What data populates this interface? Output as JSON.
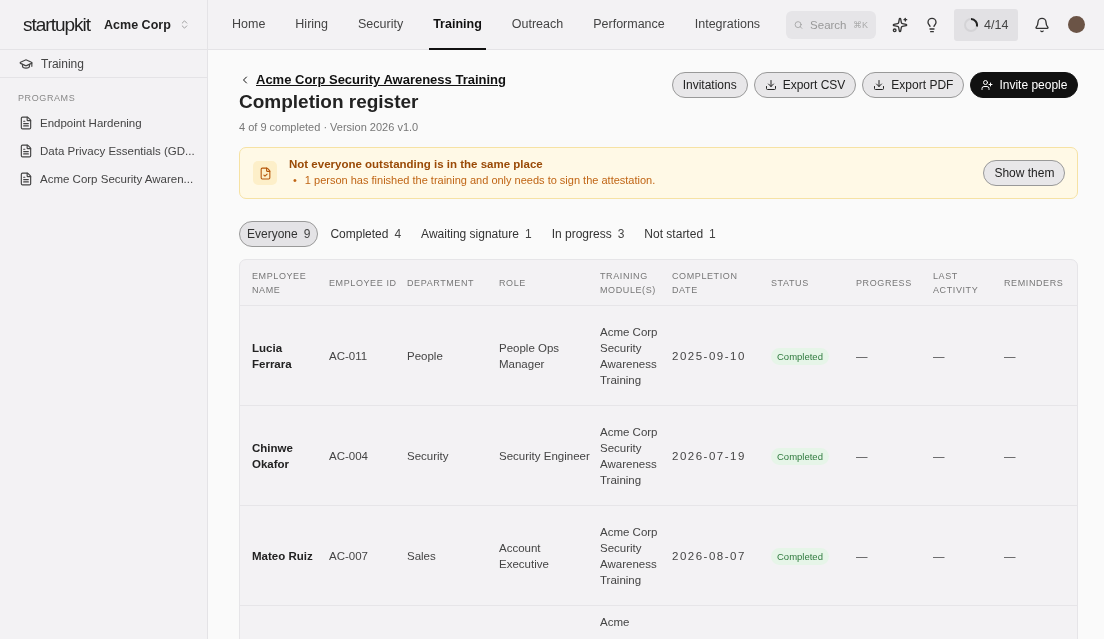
{
  "brand": {
    "logo": "startupkit",
    "org": "Acme Corp"
  },
  "nav": [
    {
      "label": "Home",
      "selected": false
    },
    {
      "label": "Hiring",
      "selected": false
    },
    {
      "label": "Security",
      "selected": false
    },
    {
      "label": "Training",
      "selected": true
    },
    {
      "label": "Outreach",
      "selected": false
    },
    {
      "label": "Performance",
      "selected": false
    },
    {
      "label": "Integrations",
      "selected": false
    }
  ],
  "search": {
    "placeholder": "Search",
    "shortcut": "⌘K"
  },
  "progress_chip": {
    "label": "4/14",
    "level": 0.29
  },
  "sidebar": {
    "header": "Training",
    "section": "PROGRAMS",
    "items": [
      {
        "label": "Endpoint Hardening",
        "selected": false
      },
      {
        "label": "Data Privacy Essentials (GD...",
        "selected": false
      },
      {
        "label": "Acme Corp Security Awaren...",
        "selected": false
      }
    ]
  },
  "page": {
    "back_link": "Acme Corp Security Awareness Training",
    "title": "Completion register",
    "subtitle": "4 of 9 completed · Version 2026 v1.0",
    "actions": [
      {
        "label": "Invitations",
        "kind": "plain"
      },
      {
        "label": "Export CSV",
        "kind": "download"
      },
      {
        "label": "Export PDF",
        "kind": "download"
      },
      {
        "label": "Invite people",
        "kind": "primary"
      }
    ]
  },
  "notice": {
    "title": "Not everyone outstanding is in the same place",
    "bullet": "•",
    "items": [
      "1 person has finished the training and only needs to sign the attestation."
    ],
    "button": "Show them"
  },
  "filters": [
    {
      "label": "Everyone",
      "count": "9",
      "selected": true
    },
    {
      "label": "Completed",
      "count": "4",
      "selected": false
    },
    {
      "label": "Awaiting signature",
      "count": "1",
      "selected": false
    },
    {
      "label": "In progress",
      "count": "3",
      "selected": false
    },
    {
      "label": "Not started",
      "count": "1",
      "selected": false
    }
  ],
  "table": {
    "columns": [
      "EMPLOYEE NAME",
      "EMPLOYEE ID",
      "DEPARTMENT",
      "ROLE",
      "TRAINING MODULE(S)",
      "COMPLETION DATE",
      "STATUS",
      "PROGRESS",
      "LAST ACTIVITY",
      "REMINDERS"
    ],
    "rows": [
      {
        "name": "Lucia Ferrara",
        "id": "AC-011",
        "department": "People",
        "role": "People Ops Manager",
        "module": "Acme Corp Security Awareness Training",
        "date": "2025-09-10",
        "status": {
          "label": "Completed",
          "kind": "completed"
        },
        "progress": "—",
        "last_activity": "—",
        "reminders": "—"
      },
      {
        "name": "Chinwe Okafor",
        "id": "AC-004",
        "department": "Security",
        "role": "Security Engineer",
        "module": "Acme Corp Security Awareness Training",
        "date": "2026-07-19",
        "status": {
          "label": "Completed",
          "kind": "completed"
        },
        "progress": "—",
        "last_activity": "—",
        "reminders": "—"
      },
      {
        "name": "Mateo Ruiz",
        "id": "AC-007",
        "department": "Sales",
        "role": "Account Executive",
        "module": "Acme Corp Security Awareness Training",
        "date": "2026-08-07",
        "status": {
          "label": "Completed",
          "kind": "completed"
        },
        "progress": "—",
        "last_activity": "—",
        "reminders": "—"
      },
      {
        "module": "Acme"
      }
    ]
  }
}
